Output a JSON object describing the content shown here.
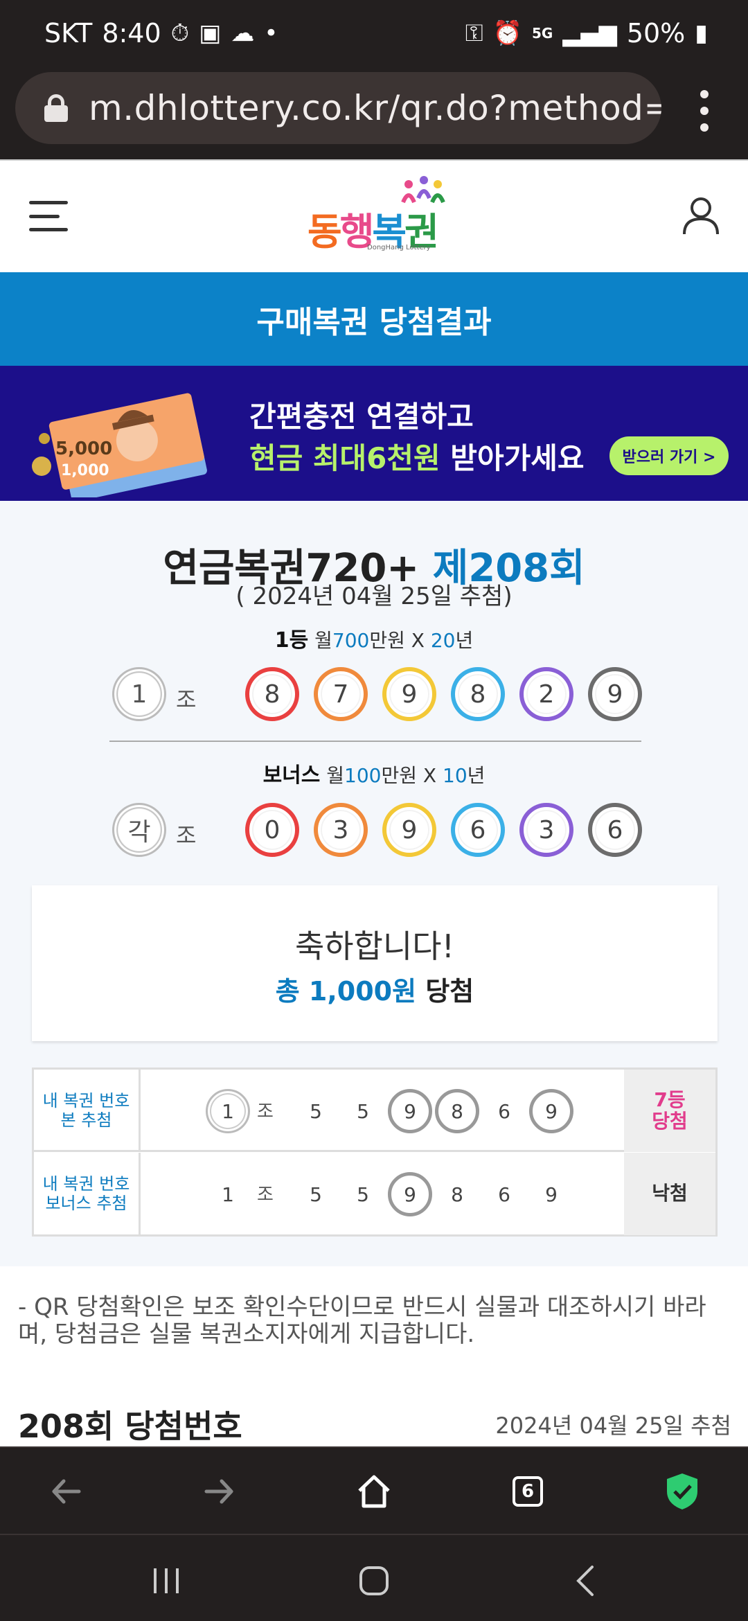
{
  "status_bar": {
    "carrier": "SKT",
    "time": "8:40",
    "network": "5G",
    "battery": "50%"
  },
  "browser": {
    "url": "m.dhlottery.co.kr/qr.do?method=w",
    "tab_count": "6"
  },
  "site": {
    "logo_text": "동행복권",
    "logo_sub": "DongHang Lottery",
    "page_title": "구매복권 당첨결과"
  },
  "banner": {
    "line1": "간편충전 연결하고",
    "line2_highlight": "현금 최대6천원",
    "line2_rest": " 받아가세요",
    "button": "받으러 가기 >",
    "bill_value": "5,000",
    "bill_value2": "1,000"
  },
  "draw": {
    "game": "연금복권720+",
    "round": "제208회",
    "date": "( 2024년 04월 25일 추첨)",
    "first": {
      "rank": "1등",
      "prefix": "월",
      "amount": "700",
      "mid": "만원 X ",
      "years": "20",
      "suffix": "년",
      "group": "1",
      "group_label": "조",
      "numbers": [
        "8",
        "7",
        "9",
        "8",
        "2",
        "9"
      ]
    },
    "bonus": {
      "rank": "보너스",
      "prefix": "월",
      "amount": "100",
      "mid": "만원 X ",
      "years": "10",
      "suffix": "년",
      "group": "각",
      "group_label": "조",
      "numbers": [
        "0",
        "3",
        "9",
        "6",
        "3",
        "6"
      ]
    }
  },
  "congrats": {
    "title": "축하합니다!",
    "amount_prefix": "총 1,000원",
    "amount_suffix": " 당첨"
  },
  "my_ticket": {
    "rows": [
      {
        "label_line1": "내 복권 번호",
        "label_line2": "본 추첨",
        "group": "1",
        "group_label": "조",
        "numbers": [
          "5",
          "5",
          "9",
          "8",
          "6",
          "9"
        ],
        "result_line1": "7등",
        "result_line2": "당첨"
      },
      {
        "label_line1": "내 복권 번호",
        "label_line2": "보너스 추첨",
        "group": "1",
        "group_label": "조",
        "numbers": [
          "5",
          "5",
          "9",
          "8",
          "6",
          "9"
        ],
        "result_line1": "낙첨",
        "result_line2": ""
      }
    ]
  },
  "notice": "- QR 당첨확인은 보조 확인수단이므로 반드시 실물과 대조하시기 바라며, 당첨금은 실물 복권소지자에게 지급합니다.",
  "section": {
    "title": "208회 당첨번호",
    "date": "2024년 04월 25일 추첨"
  },
  "colors": {
    "accent_blue": "#0c82c8",
    "banner_bg": "#1c0f8a",
    "banner_green": "#b7f16b",
    "win_pink": "#e13c8c",
    "shield_green": "#2ecc71"
  },
  "icons": [
    "lock-icon",
    "menu-dots-icon",
    "hamburger-icon",
    "user-icon",
    "back-arrow-icon",
    "forward-arrow-icon",
    "home-icon",
    "tabs-icon",
    "shield-check-icon",
    "recents-icon",
    "home-circle-icon",
    "nav-back-icon"
  ]
}
